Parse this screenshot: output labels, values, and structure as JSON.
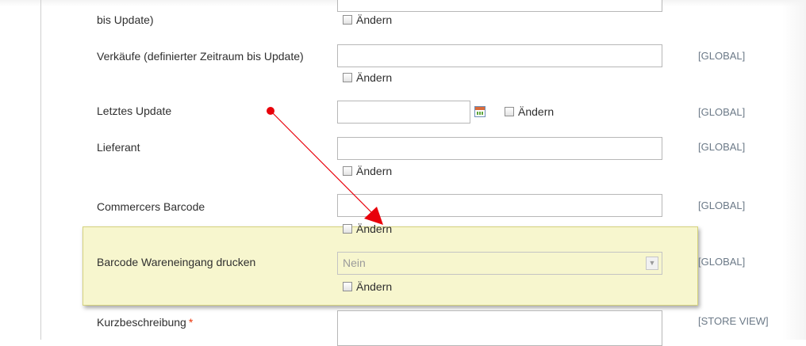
{
  "change_label": "Ändern",
  "rows": [
    {
      "label": "bis Update)"
    },
    {
      "label": "Verkäufe (definierter Zeitraum bis Update)",
      "scope": "[GLOBAL]"
    },
    {
      "label": "Letztes Update",
      "scope": "[GLOBAL]"
    },
    {
      "label": "Lieferant",
      "scope": "[GLOBAL]"
    },
    {
      "label": "Commercers Barcode",
      "scope": "[GLOBAL]"
    },
    {
      "label": "Barcode Wareneingang drucken",
      "scope": "[GLOBAL]",
      "value": "Nein"
    },
    {
      "label": "Kurzbeschreibung",
      "required_mark": "*",
      "scope": "[STORE VIEW]"
    }
  ],
  "annotation": {
    "color": "#e8000a"
  }
}
